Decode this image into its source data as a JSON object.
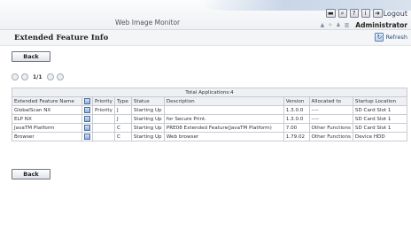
{
  "app": {
    "title": "Web Image Monitor",
    "user": "Administrator",
    "logout_label": "Logout"
  },
  "header": {
    "title": "Extended Feature Info",
    "refresh_label": "Refresh"
  },
  "buttons": {
    "back_label": "Back"
  },
  "pager": {
    "text": "1/1"
  },
  "table": {
    "total_label": "Total Applications:4",
    "columns": [
      "Extended Feature Name",
      "",
      "Priority",
      "Type",
      "Status",
      "Description",
      "Version",
      "Allocated to",
      "Startup Location"
    ],
    "rows": [
      {
        "name": "GlobalScan NX",
        "priority": "Priority",
        "type": "J",
        "status": "Starting Up",
        "description": "",
        "version": "1.3.0.0",
        "allocated": "----",
        "location": "SD Card Slot 1"
      },
      {
        "name": "ELP NX",
        "priority": "",
        "type": "J",
        "status": "Starting Up",
        "description": "for Secure Print.",
        "version": "1.3.0.0",
        "allocated": "----",
        "location": "SD Card Slot 1"
      },
      {
        "name": "JavaTM Platform",
        "priority": "",
        "type": "C",
        "status": "Starting Up",
        "description": "PRE08 Extended Feature(JavaTM Platform)",
        "version": "7.00",
        "allocated": "Other Functions",
        "location": "SD Card Slot 1"
      },
      {
        "name": "Browser",
        "priority": "",
        "type": "C",
        "status": "Starting Up",
        "description": "Web browser",
        "version": "1.79.02",
        "allocated": "Other Functions",
        "location": "Device HDD"
      }
    ]
  }
}
